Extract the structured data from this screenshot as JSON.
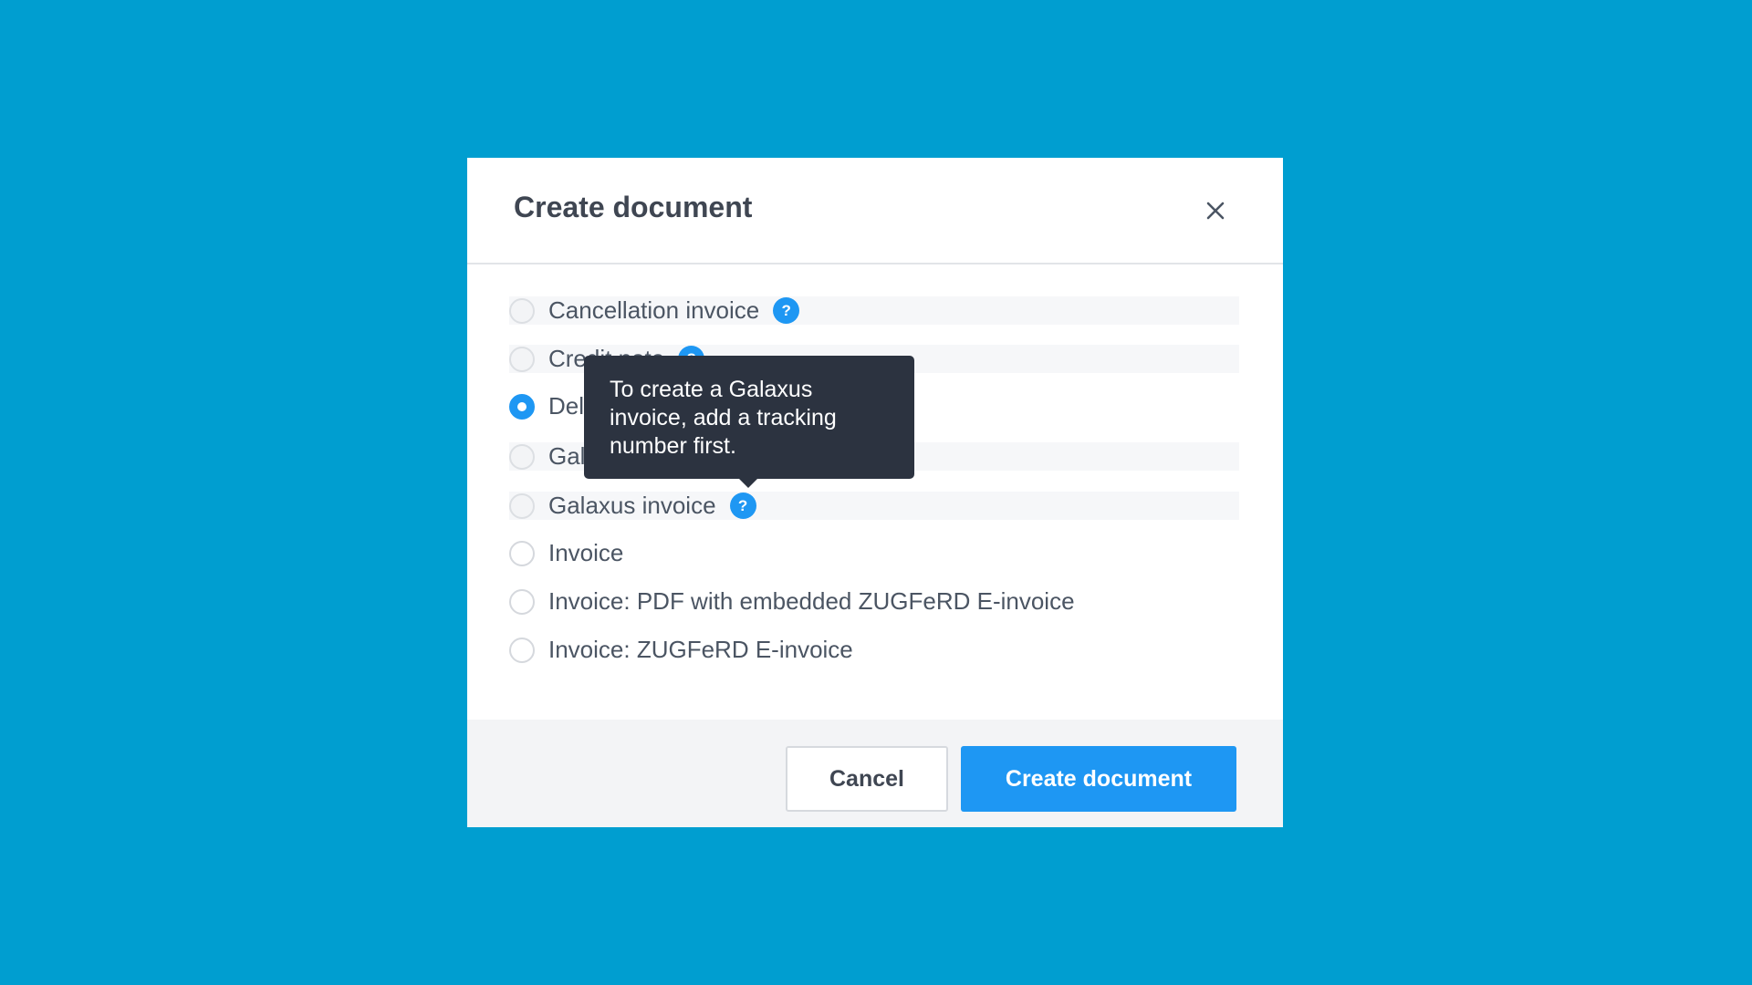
{
  "dialog": {
    "title": "Create document",
    "options": [
      {
        "label": "Cancellation invoice",
        "state": "disabled",
        "help": true
      },
      {
        "label": "Credit note",
        "state": "disabled",
        "help": true
      },
      {
        "label": "Delivery note",
        "state": "checked",
        "help": false
      },
      {
        "label": "Galaxus delivery note",
        "state": "disabled",
        "help": false
      },
      {
        "label": "Galaxus invoice",
        "state": "disabled",
        "help": true
      },
      {
        "label": "Invoice",
        "state": "enabled",
        "help": false
      },
      {
        "label": "Invoice: PDF with embedded ZUGFeRD E-invoice",
        "state": "enabled",
        "help": false
      },
      {
        "label": "Invoice: ZUGFeRD E-invoice",
        "state": "enabled",
        "help": false
      }
    ],
    "help_icon_glyph": "?",
    "tooltip": "To create a Galaxus invoice, add a tracking number first.",
    "buttons": {
      "cancel": "Cancel",
      "create": "Create document"
    }
  },
  "colors": {
    "background": "#009ed0",
    "accent": "#1e97f3",
    "tooltip_bg": "#2c3340"
  },
  "icons": {
    "close": "close-icon",
    "help": "question-circle-icon"
  }
}
